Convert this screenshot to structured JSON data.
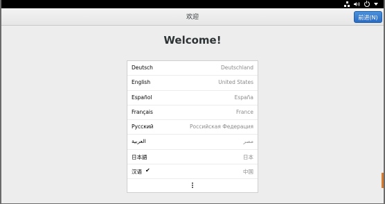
{
  "header": {
    "title": "欢迎",
    "next_label": "前进(N)"
  },
  "main": {
    "heading": "Welcome!"
  },
  "languages": [
    {
      "name": "Deutsch",
      "country": "Deutschland"
    },
    {
      "name": "English",
      "country": "United States"
    },
    {
      "name": "Español",
      "country": "España"
    },
    {
      "name": "Français",
      "country": "France"
    },
    {
      "name": "Русский",
      "country": "Российская Федерация"
    },
    {
      "name": "العربية",
      "country": "مصر"
    },
    {
      "name": "日本語",
      "country": "日本"
    },
    {
      "name": "汉语",
      "country": "中国",
      "selected": true
    }
  ],
  "selected_mark": "✔",
  "icons": {
    "network": "network-icon",
    "volume": "volume-icon",
    "power": "power-icon",
    "menu": "chevron-down-icon",
    "more": "more-vertical-icon"
  },
  "colors": {
    "accent": "#2b6cc4",
    "topbar": "#000000",
    "background": "#ededed"
  }
}
